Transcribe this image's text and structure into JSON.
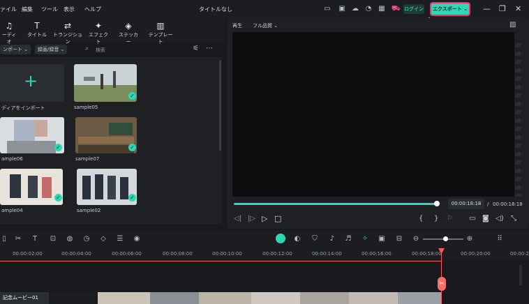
{
  "menu": [
    "ァイル",
    "編集",
    "ツール",
    "表示",
    "ヘルプ"
  ],
  "app_title": "タイトルなし",
  "header": {
    "login_label": "ログイン",
    "export_label": "エクスポート ⌄"
  },
  "toolbar": [
    {
      "label": "ーディオ",
      "icon": "music-note-icon"
    },
    {
      "label": "タイトル",
      "icon": "text-icon"
    },
    {
      "label": "トランジション",
      "icon": "transition-icon"
    },
    {
      "label": "エフェクト",
      "icon": "effect-icon"
    },
    {
      "label": "ステッカー",
      "icon": "sticker-icon"
    },
    {
      "label": "テンプレート",
      "icon": "template-icon"
    }
  ],
  "filter": {
    "import_label": "ンポート ⌄",
    "record_label": "録画/録音 ⌄",
    "search_placeholder": "検索"
  },
  "media": {
    "import_tile_label": "ディアをインポート",
    "items": [
      {
        "label": "sample05"
      },
      {
        "label": "ample06"
      },
      {
        "label": "sample07"
      },
      {
        "label": "ample04"
      },
      {
        "label": "sample02"
      }
    ]
  },
  "preview": {
    "play_label": "再生",
    "quality_label": "フル品質 ⌄",
    "time_current": "00:00:18:18",
    "time_separator": "/",
    "time_total": "00:00:18:18"
  },
  "timeline": {
    "ticks": [
      "00:00:02:00",
      "00:00:04:00",
      "00:00:06:00",
      "00:00:08:00",
      "00:00:10:00",
      "00:00:12:00",
      "00:00:14:00",
      "00:00:16:00",
      "00:00:18:00",
      "00:00:20:00",
      "00:00:2"
    ],
    "clip_label": "記念ムービー01"
  },
  "colors": {
    "accent": "#2fd6b4",
    "highlight": "#ff2a74",
    "playhead": "#ff5a5a"
  }
}
